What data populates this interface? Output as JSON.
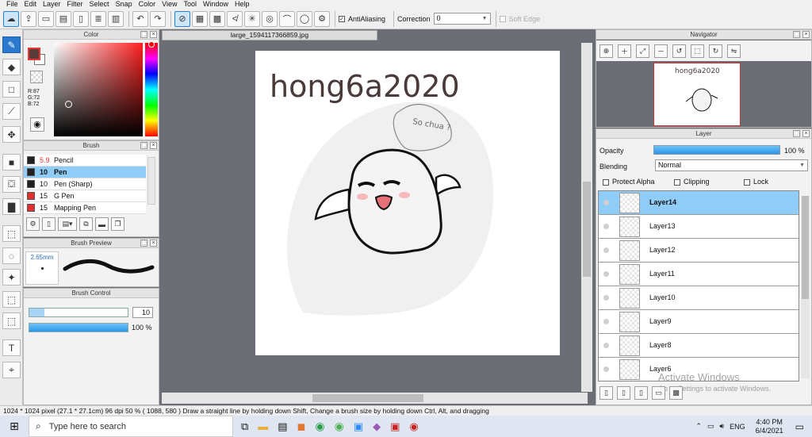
{
  "menu": [
    "File",
    "Edit",
    "Layer",
    "Filter",
    "Select",
    "Snap",
    "Color",
    "View",
    "Tool",
    "Window",
    "Help"
  ],
  "toolbar": {
    "antialias_label": "AntiAliasing",
    "correction_label": "Correction",
    "correction_value": "0",
    "soft_edge_label": "Soft Edge"
  },
  "color_panel": {
    "title": "Color",
    "r": "R:87",
    "g": "G:72",
    "b": "B:72",
    "foreground": "#573c3c",
    "background": "#ffffff"
  },
  "brush_panel": {
    "title": "Brush",
    "items": [
      {
        "size": "5.9",
        "name": "Pencil",
        "color": "#222222",
        "size_color": "#d33"
      },
      {
        "size": "10",
        "name": "Pen",
        "color": "#222222",
        "size_color": "#111"
      },
      {
        "size": "10",
        "name": "Pen (Sharp)",
        "color": "#222222",
        "size_color": "#111"
      },
      {
        "size": "15",
        "name": "G Pen",
        "color": "#e03030",
        "size_color": "#111"
      },
      {
        "size": "15",
        "name": "Mapping Pen",
        "color": "#e03030",
        "size_color": "#111"
      }
    ]
  },
  "brush_preview": {
    "title": "Brush Preview",
    "size": "2.65mm"
  },
  "brush_control": {
    "title": "Brush Control",
    "size_value": "10",
    "opacity_value": "100 %",
    "size_fraction": 0.15,
    "opacity_fraction": 1.0
  },
  "document": {
    "tab_title": "large_1594117366859.jpg",
    "signature": "hong6a2020",
    "bubble_text": "So chua ?"
  },
  "navigator": {
    "title": "Navigator"
  },
  "layer_panel": {
    "title": "Layer",
    "opacity_label": "Opacity",
    "opacity_value": "100 %",
    "blending_label": "Blending",
    "blending_value": "Normal",
    "protect_alpha": "Protect Alpha",
    "clipping": "Clipping",
    "lock": "Lock",
    "layers": [
      "Layer14",
      "Layer13",
      "Layer12",
      "Layer11",
      "Layer10",
      "Layer9",
      "Layer8",
      "Layer6"
    ],
    "selected": 0
  },
  "watermark": {
    "line1": "Activate Windows",
    "line2": "Go to Settings to activate Windows."
  },
  "status": "1024 * 1024 pixel   (27.1 * 27.1cm)   96 dpi   50 %   ( 1088, 580 )   Draw a straight line by holding down Shift, Change a brush size by holding down Ctrl, Alt, and dragging",
  "taskbar": {
    "search_placeholder": "Type here to search",
    "lang": "ENG",
    "time": "4:40 PM",
    "date": "6/4/2021"
  }
}
